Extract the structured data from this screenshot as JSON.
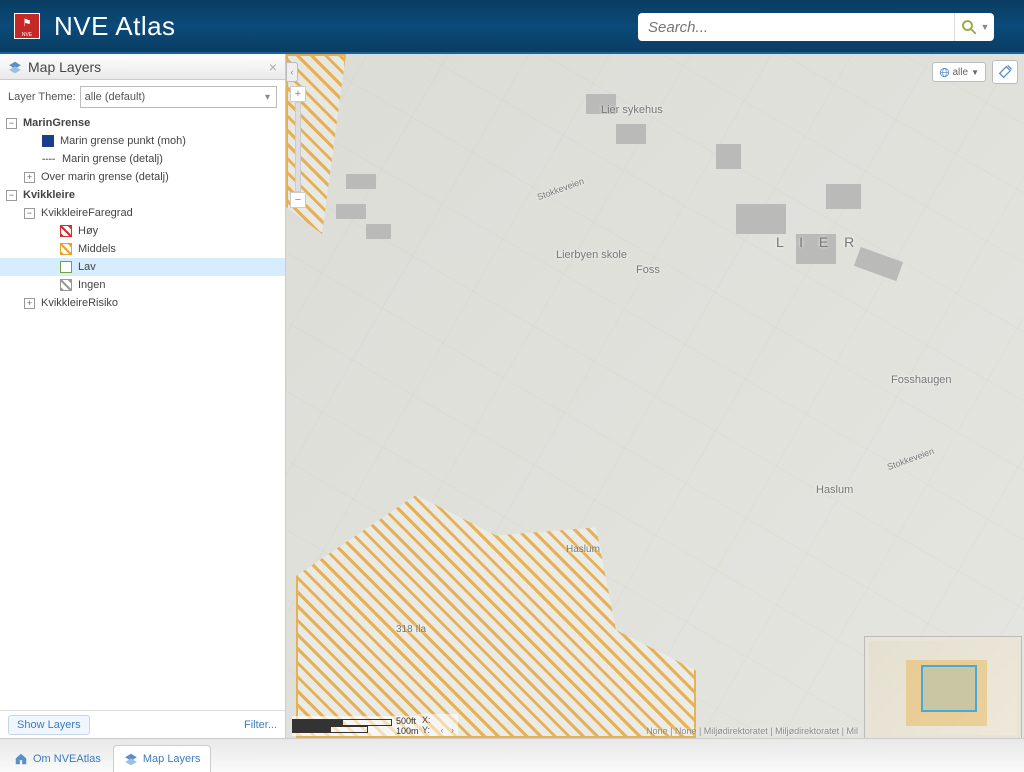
{
  "header": {
    "app_title": "NVE Atlas",
    "logo_text": "NVE",
    "search_placeholder": "Search..."
  },
  "sidebar": {
    "panel_title": "Map Layers",
    "theme_label": "Layer Theme:",
    "theme_value": "alle (default)",
    "tree": {
      "marin_grense": "MarinGrense",
      "marin_punkt": "Marin grense punkt (moh)",
      "marin_detalj": "Marin grense (detalj)",
      "over_marin": "Over marin grense (detalj)",
      "kvikkleire": "Kvikkleire",
      "faregrad": "KvikkleireFaregrad",
      "hoy": "Høy",
      "middels": "Middels",
      "lav": "Lav",
      "ingen": "Ingen",
      "risiko": "KvikkleireRisiko"
    },
    "show_layers": "Show Layers",
    "filter": "Filter..."
  },
  "map": {
    "labels": {
      "lier": "L I E R",
      "lierbyen": "Lierbyen skole",
      "liersykehus": "Lier sykehus",
      "foss": "Foss",
      "fosshaugen": "Fosshaugen",
      "haslum": "Haslum",
      "haslum2": "Haslum",
      "ila": "318 Ila",
      "stokkeveien": "Stokkeveien",
      "stokkeveien2": "Stokkeveien"
    },
    "layer_switch": "alle",
    "scale": {
      "ft": "500ft",
      "m": "100m"
    },
    "coord": {
      "x": "X:",
      "y": "Y:"
    },
    "attribution": "None | None | Miljødirektoratet | Miljødirektoratet | Mil"
  },
  "tabs": {
    "om": "Om NVEAtlas",
    "layers": "Map Layers"
  }
}
